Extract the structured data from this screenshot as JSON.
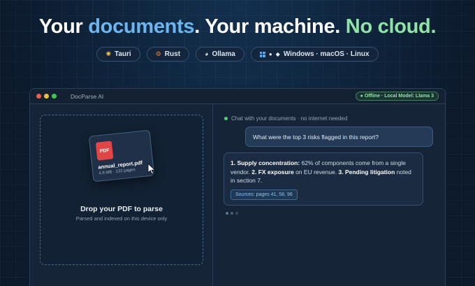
{
  "hero": {
    "part1": "Your ",
    "part2": "documents",
    "part3": ". Your machine. ",
    "part4": "No cloud."
  },
  "pills": [
    {
      "icon": "tauri-icon",
      "label": "Tauri"
    },
    {
      "icon": "rust-icon",
      "label": "Rust"
    },
    {
      "icon": "ollama-icon",
      "label": "Ollama"
    },
    {
      "icons": [
        "windows-icon",
        "apple-icon",
        "linux-icon"
      ],
      "label": "Windows · macOS · Linux"
    }
  ],
  "window": {
    "app_name": "DocParse AI",
    "status": "● Offline · Local Model: Llama 3"
  },
  "dropzone": {
    "file_badge": "PDF",
    "file_name": "annual_report.pdf",
    "file_meta": "4.8 MB · 132 pages",
    "title": "Drop your PDF to parse",
    "subtitle": "Parsed and indexed on this device only"
  },
  "chat": {
    "header": "Chat with your documents · no internet needed",
    "user_message": "What were the top 3 risks flagged in this report?",
    "ai": {
      "r1_title": "1. Supply concentration:",
      "r1_text": " 62% of components come from a single vendor. ",
      "r2_title": "2. FX exposure",
      "r2_text": " on EU revenue. ",
      "r3_title": "3. Pending litigation",
      "r3_text": " noted in section 7."
    },
    "sources": "Sources: pages 41, 58, 96"
  },
  "colors": {
    "accent_blue": "#6cb6f0",
    "accent_green": "#8fe3a4",
    "pdf_red": "#e04646"
  }
}
